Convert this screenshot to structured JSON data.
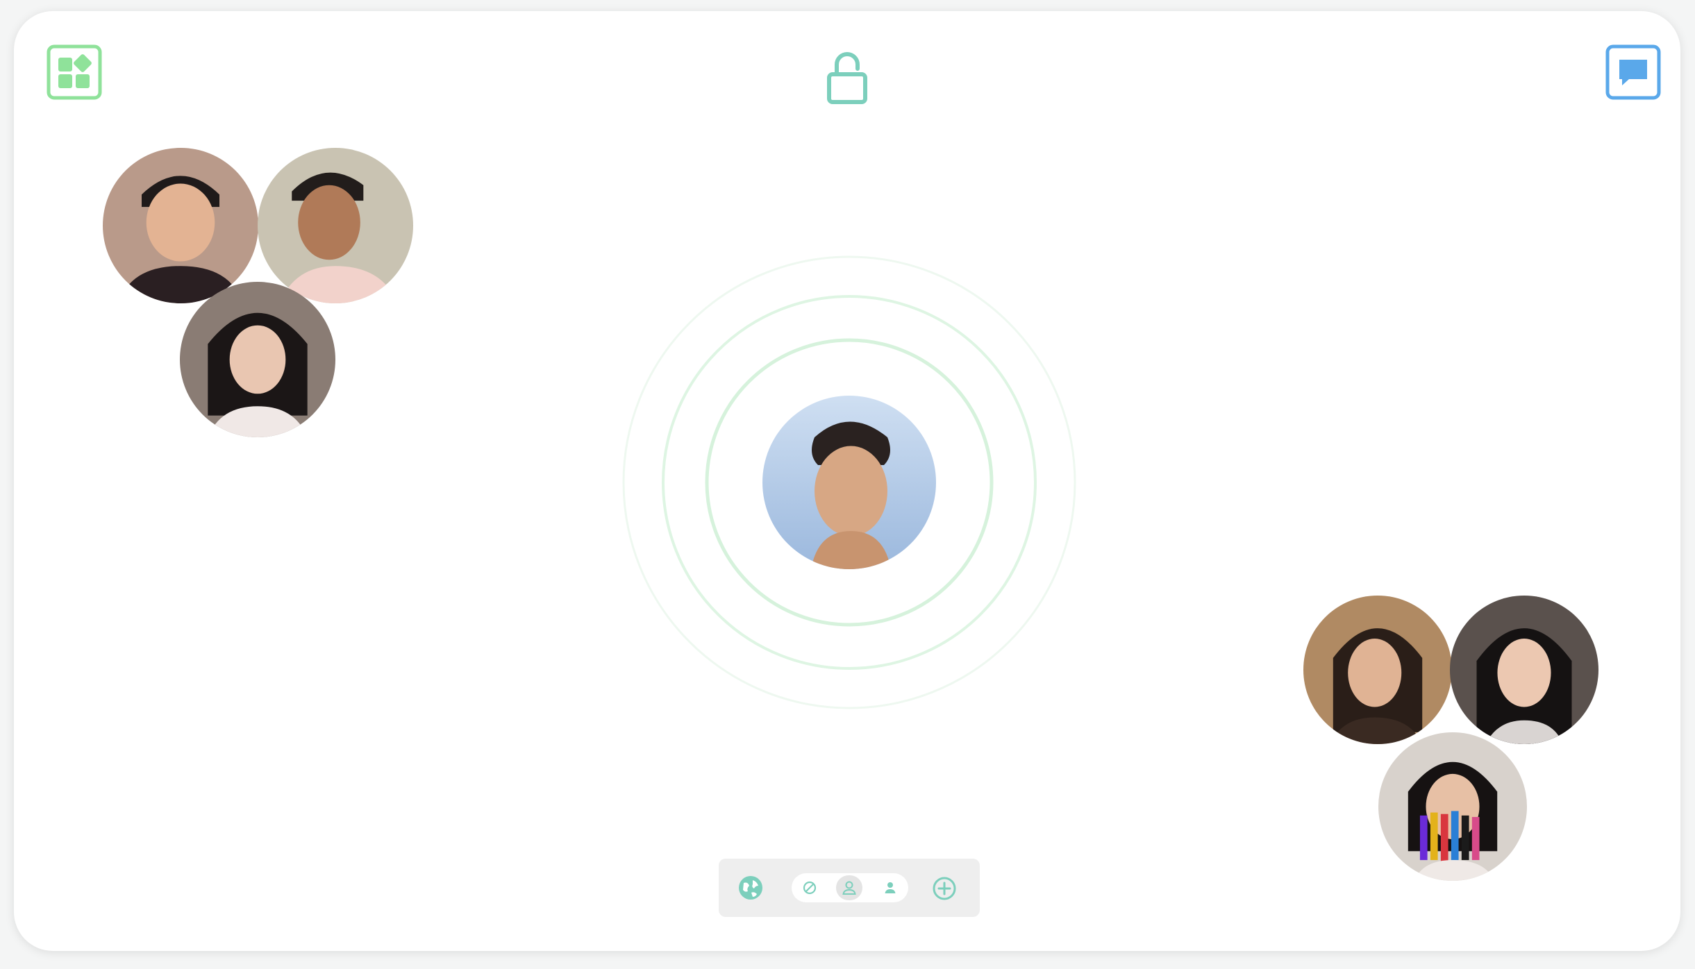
{
  "window": {
    "background": "#ffffff",
    "accent_green": "#8fe29a",
    "accent_teal": "#7ccfbc",
    "accent_blue": "#5aa8ea"
  },
  "header": {
    "left_icon": "apps-grid-icon",
    "center_icon": "unlocked-padlock-icon",
    "right_icon": "chat-bubble-icon"
  },
  "center_user": {
    "icon": "avatar"
  },
  "groups": [
    {
      "name_hidden": true,
      "members": 3
    },
    {
      "name_hidden": true,
      "members": 3
    }
  ],
  "toolbar": {
    "items": [
      "globe-icon",
      "do-not-disturb-icon",
      "person-outline-icon",
      "person-filled-icon",
      "add-circle-icon"
    ],
    "selected": "person-outline-icon"
  }
}
